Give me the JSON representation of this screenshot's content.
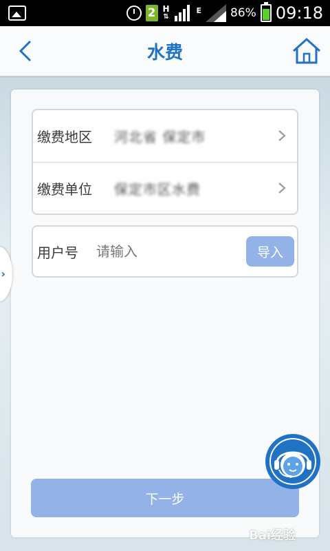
{
  "status_bar": {
    "notification_count": "2",
    "network_h": "H",
    "network_e": "E",
    "battery": "86%",
    "time": "09:18",
    "battery_color": "#5bd12c"
  },
  "header": {
    "title": "水费",
    "back_icon": "chevron-left-icon",
    "home_icon": "home-icon",
    "accent_color": "#1f72c4"
  },
  "form": {
    "region_label": "缴费地区",
    "region_value": "河北省 保定市",
    "unit_label": "缴费单位",
    "unit_value": "保定市区水费",
    "user_id_label": "用户号",
    "user_id_placeholder": "请输入",
    "user_id_value": "",
    "import_label": "导入"
  },
  "next_label": "下一步",
  "watermark": "Bai经验",
  "button_color": "#93b3e8"
}
